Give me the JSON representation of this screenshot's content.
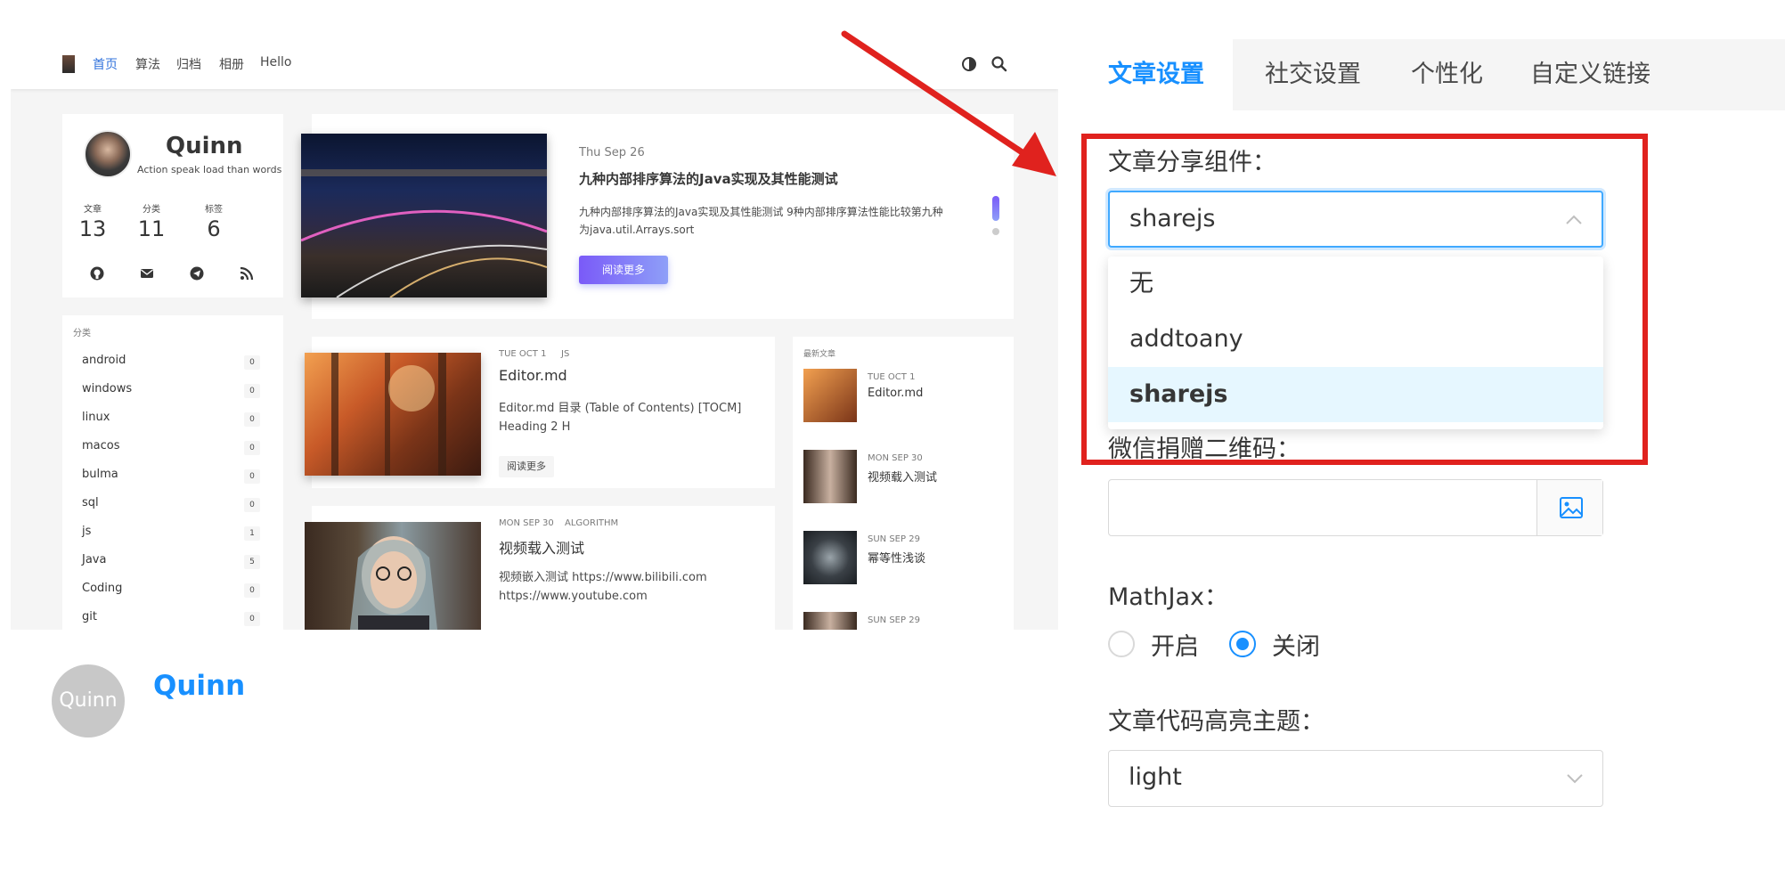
{
  "nav": {
    "items": [
      "首页",
      "算法",
      "归档",
      "相册",
      "Hello"
    ]
  },
  "profile": {
    "name": "Quinn",
    "motto": "Action speak load than words",
    "stats": [
      {
        "label": "文章",
        "value": "13"
      },
      {
        "label": "分类",
        "value": "11"
      },
      {
        "label": "标签",
        "value": "6"
      }
    ]
  },
  "categories": {
    "title": "分类",
    "items": [
      {
        "name": "android",
        "count": "0"
      },
      {
        "name": "windows",
        "count": "0"
      },
      {
        "name": "linux",
        "count": "0"
      },
      {
        "name": "macos",
        "count": "0"
      },
      {
        "name": "bulma",
        "count": "0"
      },
      {
        "name": "sql",
        "count": "0"
      },
      {
        "name": "js",
        "count": "1"
      },
      {
        "name": "Java",
        "count": "5"
      },
      {
        "name": "Coding",
        "count": "0"
      },
      {
        "name": "git",
        "count": "0"
      }
    ]
  },
  "featured": {
    "date": "Thu Sep 26",
    "title": "九种内部排序算法的Java实现及其性能测试",
    "excerpt1": "九种内部排序算法的Java实现及其性能测试 9种内部排序算法性能比较第九种",
    "excerpt2": "为java.util.Arrays.sort",
    "button": "阅读更多"
  },
  "posts": [
    {
      "date": "TUE OCT 1",
      "category": "JS",
      "title": "Editor.md",
      "excerpt1": "Editor.md 目录 (Table of Contents) [TOCM]",
      "excerpt2": "Heading 2 H",
      "button": "阅读更多"
    },
    {
      "date": "MON SEP 30",
      "category": "ALGORITHM",
      "title": "视频载入测试",
      "excerpt1": "视频嵌入测试 https://www.bilibili.com",
      "excerpt2": "https://www.youtube.com"
    }
  ],
  "recent": {
    "title": "最新文章",
    "items": [
      {
        "date": "TUE OCT 1",
        "title": "Editor.md"
      },
      {
        "date": "MON SEP 30",
        "title": "视频载入测试"
      },
      {
        "date": "SUN SEP 29",
        "title": "幂等性浅谈"
      },
      {
        "date": "SUN SEP 29",
        "title": ""
      }
    ]
  },
  "author_bottom": {
    "avatar_text": "Quinn",
    "name": "Quinn"
  },
  "settings": {
    "tabs": [
      "文章设置",
      "社交设置",
      "个性化",
      "自定义链接"
    ],
    "share_label": "文章分享组件：",
    "share_value": "sharejs",
    "share_options": [
      "无",
      "addtoany",
      "sharejs"
    ],
    "wechat_label": "微信捐赠二维码：",
    "wechat_value": "",
    "mathjax_label": "MathJax：",
    "mathjax_on": "开启",
    "mathjax_off": "关闭",
    "mathjax_selected": "关闭",
    "code_theme_label": "文章代码高亮主题：",
    "code_theme_value": "light"
  },
  "colors": {
    "accent": "#1890ff",
    "annotation": "#e0221e",
    "nav_active": "#3273dc"
  }
}
